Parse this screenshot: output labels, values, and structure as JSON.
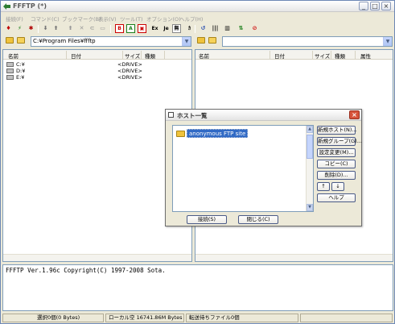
{
  "window": {
    "title": "FFFTP (*)",
    "min_label": "_",
    "max_label": "□",
    "close_label": "×"
  },
  "menu": [
    "接続(F)",
    "コマンド(C)",
    "ブックマーク(B)",
    "表示(V)",
    "ツール(T)",
    "オプション(O)",
    "ヘルプ(H)"
  ],
  "toolbar": {
    "text_buttons": [
      "B",
      "A",
      "Ex",
      "Je",
      "無"
    ]
  },
  "local": {
    "path": "C:¥Program Files¥ffftp",
    "columns": [
      "名前",
      "日付",
      "サイズ",
      "種類"
    ],
    "items": [
      {
        "name": "C:¥",
        "size": "<DRIVE>"
      },
      {
        "name": "D:¥",
        "size": "<DRIVE>"
      },
      {
        "name": "E:¥",
        "size": "<DRIVE>"
      }
    ]
  },
  "remote": {
    "path": "",
    "columns": [
      "名前",
      "日付",
      "サイズ",
      "種類",
      "属性"
    ]
  },
  "log": {
    "text": "FFFTP Ver.1.96c Copyright(C) 1997-2008 Sota."
  },
  "status": {
    "selected": "選択0個(0 Bytes)",
    "local_free": "ローカル空 16741.86M Bytes",
    "queue": "転送待ちファイル0個"
  },
  "dialog": {
    "title": "ホスト一覧",
    "close_label": "×",
    "host_items": [
      "anonymous FTP site"
    ],
    "buttons": {
      "new_host": "新規ホスト(N)...",
      "new_group": "新規グループ(G)...",
      "edit_settings": "設定変更(M)...",
      "copy": "コピー(C)",
      "delete": "削除(D)...",
      "up": "↑",
      "down": "↓",
      "help": "ヘルプ",
      "connect": "接続(S)",
      "close": "閉じる(C)"
    }
  },
  "colors": {
    "selection": "#316ac5",
    "face": "#ece9d8",
    "border": "#7f9db9"
  }
}
